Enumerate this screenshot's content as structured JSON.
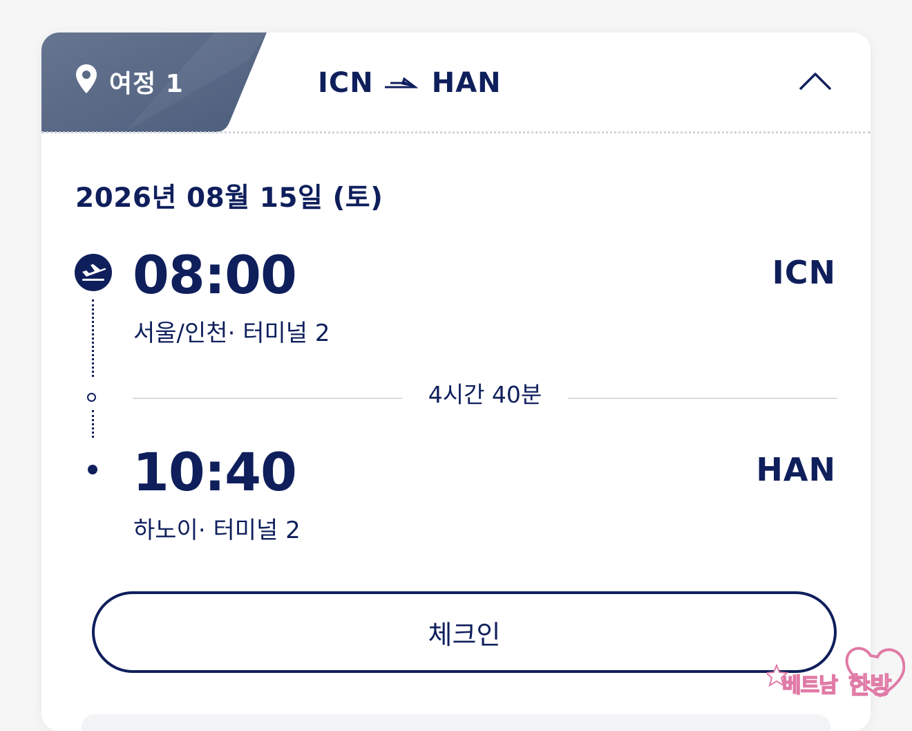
{
  "header": {
    "trip_label": "여정 1",
    "route_from": "ICN",
    "route_to": "HAN",
    "icons": {
      "trip": "location-pin-icon",
      "route_arrow": "flight-arrow-icon",
      "collapse": "chevron-up-icon"
    }
  },
  "flight": {
    "date": "2026년 08월 15일 (토)",
    "departure": {
      "time": "08:00",
      "code": "ICN",
      "place": "서울/인천· 터미널  2",
      "icon": "takeoff-icon"
    },
    "duration": "4시간 40분",
    "arrival": {
      "time": "10:40",
      "code": "HAN",
      "place": "하노이· 터미널  2"
    }
  },
  "actions": {
    "checkin_label": "체크인"
  },
  "watermark": {
    "main": "베트남",
    "accent": "한방"
  },
  "colors": {
    "primary": "#0f1f5c",
    "tab": "#5a6b87",
    "divider": "#d9dce2",
    "watermark": "#e07aa6"
  }
}
